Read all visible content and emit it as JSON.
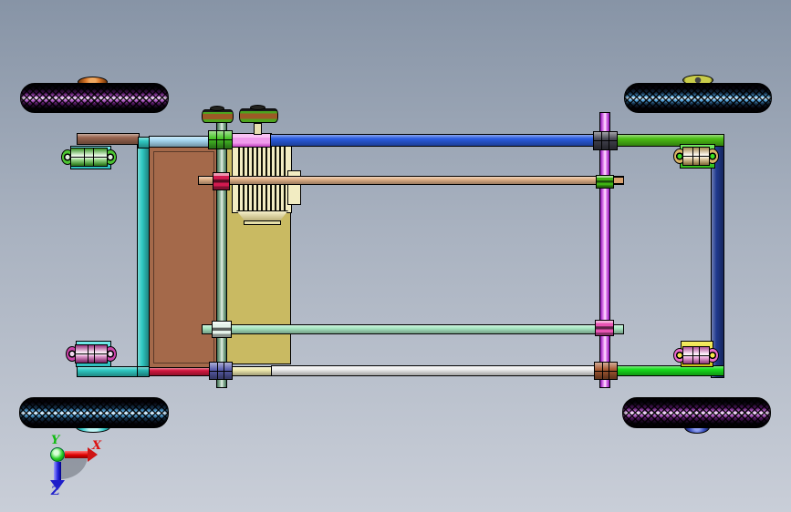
{
  "axis_triad": {
    "x_label": "X",
    "y_label": "Y",
    "z_label": "Z",
    "x_color": "#dd1111",
    "y_color": "#11bb11",
    "z_color": "#2222cc"
  },
  "palette": {
    "bg_top": "#8794a6",
    "bg_mid": "#a9b2c0",
    "bg_bottom": "#c9ced8",
    "tire_dark": "#07040c",
    "tire_purple_mid": "#4b1459",
    "tire_purple_hi": "#c168d6",
    "tire_blue_mid": "#16344f",
    "tire_blue_hi": "#59aee8",
    "hub_orange": "#d9772a",
    "hub_olive": "#c9cc4a",
    "hub_cyan": "#3ed2d2",
    "hub_blue": "#3a50c0",
    "panel_brown": "#a4694a",
    "panel_khaki": "#c9ba62",
    "motor_cream": "#f2ecc2",
    "motor_pink": "#ef9aeb",
    "pulley_copper": "#9c5a26",
    "pulley_green": "#4da41e",
    "shaft_green_light": "#a8c9b1",
    "shaft_green_dark": "#3f6e52",
    "axle_magenta_light": "#ee9af6",
    "axle_magenta_dark": "#8b0cb4",
    "rail_brown": "#9a6650",
    "rail_lightblue": "#a6d9f2",
    "rail_blue": "#2a5ce0",
    "rail_green_top": "#4bbd14",
    "rail_navy": "#20398e",
    "rail_cyan": "#2fc8c2",
    "rail_crimson": "#d2173f",
    "rail_pale_yellow": "#efe9ae",
    "rail_white": "#efefef",
    "rail_bright_green": "#17dd1c",
    "bar_tan": "#e2b289",
    "bar_lightgreen": "#a9e9c4",
    "clamp_green": "#46c426",
    "coupling_black": "#43434f",
    "coupling_slate": "#5b5fae",
    "coupling_copper": "#a85a32",
    "collar_crimson": "#d21a50",
    "collar_green": "#3fb312",
    "collar_pink": "#e954b4",
    "flange_white": "#e4f1e9",
    "plate_cyan": "#35e0e0",
    "plate_green": "#3adf20",
    "plate_yellow": "#f2e41f",
    "bearing_green": "#4cc432",
    "bearing_tan": "#d9b468",
    "bearing_magenta": "#c944a8",
    "bearing_pink": "#e96acb",
    "axis_shadow": "#5f6670"
  }
}
